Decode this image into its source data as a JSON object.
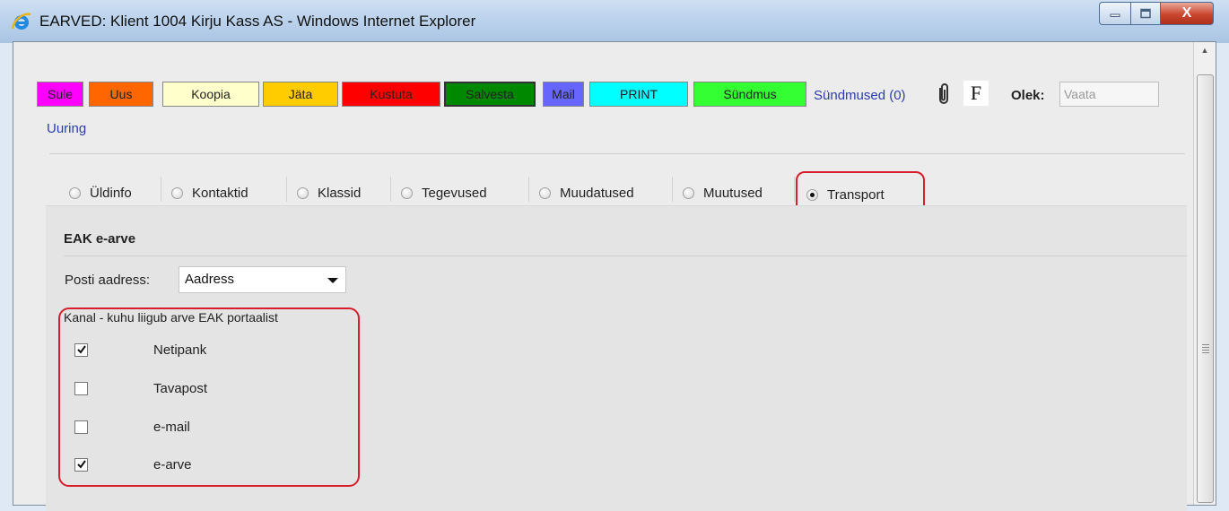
{
  "window": {
    "title": "EARVED: Klient 1004  Kirju Kass AS - Windows Internet Explorer",
    "buttons": {
      "minimize": "▭",
      "maximize": "▢",
      "close": "X"
    }
  },
  "toolbar": {
    "buttons": [
      {
        "label": "Sule",
        "color": "#ff00ff"
      },
      {
        "label": "Uus",
        "color": "#ff6600"
      },
      {
        "label": "Koopia",
        "color": "#ffffcc"
      },
      {
        "label": "Jäta",
        "color": "#ffcc00"
      },
      {
        "label": "Kustuta",
        "color": "#ff0000"
      },
      {
        "label": "Salvesta",
        "color": "#008800"
      },
      {
        "label": "Mail",
        "color": "#6666ff"
      },
      {
        "label": "PRINT",
        "color": "#00ffff"
      },
      {
        "label": "Sündmus",
        "color": "#33ff33"
      }
    ],
    "sundmused_link": "Sündmused (0)",
    "f_label": "F",
    "olek_label": "Olek:",
    "olek_value": "Vaata",
    "uuring_link": "Uuring"
  },
  "tabs": [
    {
      "label": "Üldinfo",
      "selected": false
    },
    {
      "label": "Kontaktid",
      "selected": false
    },
    {
      "label": "Klassid",
      "selected": false
    },
    {
      "label": "Tegevused",
      "selected": false
    },
    {
      "label": "Muudatused",
      "selected": false
    },
    {
      "label": "Muutused",
      "selected": false
    },
    {
      "label": "Transport",
      "selected": true
    }
  ],
  "section": {
    "title": "EAK e-arve",
    "posti_label": "Posti aadress:",
    "posti_value": "Aadress",
    "kanal_title": "Kanal - kuhu liigub arve EAK portaalist",
    "channels": [
      {
        "label": "Netipank",
        "checked": true
      },
      {
        "label": "Tavapost",
        "checked": false
      },
      {
        "label": "e-mail",
        "checked": false
      },
      {
        "label": "e-arve",
        "checked": true
      }
    ]
  }
}
